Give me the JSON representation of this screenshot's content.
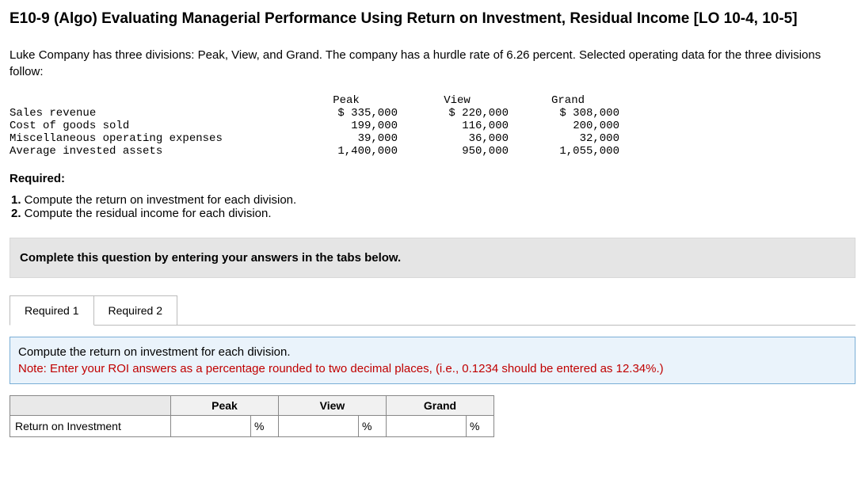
{
  "title": "E10-9 (Algo) Evaluating Managerial Performance Using Return on Investment, Residual Income [LO 10-4, 10-5]",
  "intro": "Luke Company has three divisions: Peak, View, and Grand. The company has a hurdle rate of 6.26 percent. Selected operating data for the three divisions follow:",
  "chart_data": {
    "type": "table",
    "headers": [
      "",
      "Peak",
      "View",
      "Grand"
    ],
    "rows": [
      {
        "label": "Sales revenue",
        "peak": "$ 335,000",
        "view": "$ 220,000",
        "grand": "$ 308,000"
      },
      {
        "label": "Cost of goods sold",
        "peak": "199,000",
        "view": "116,000",
        "grand": "200,000"
      },
      {
        "label": "Miscellaneous operating expenses",
        "peak": "39,000",
        "view": "36,000",
        "grand": "32,000"
      },
      {
        "label": "Average invested assets",
        "peak": "1,400,000",
        "view": "950,000",
        "grand": "1,055,000"
      }
    ]
  },
  "required_heading": "Required:",
  "required_items": [
    {
      "num": "1.",
      "text": " Compute the return on investment for each division."
    },
    {
      "num": "2.",
      "text": " Compute the residual income for each division."
    }
  ],
  "instruction_bar": "Complete this question by entering your answers in the tabs below.",
  "tabs": [
    {
      "label": "Required 1",
      "active": true
    },
    {
      "label": "Required 2",
      "active": false
    }
  ],
  "prompt": {
    "line1": "Compute the return on investment for each division.",
    "note": "Note: Enter your ROI answers as a percentage rounded to two decimal places, (i.e., 0.1234 should be entered as 12.34%.)"
  },
  "answer_table": {
    "headers": [
      "Peak",
      "View",
      "Grand"
    ],
    "row_label": "Return on Investment",
    "unit": "%"
  }
}
